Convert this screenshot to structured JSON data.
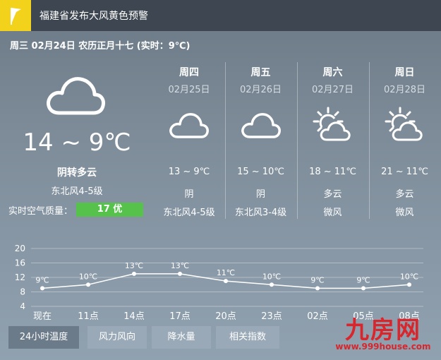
{
  "alert": {
    "text": "福建省发布大风黄色预警",
    "icon": "flag-icon",
    "color": "#f2d21b"
  },
  "date_line": "周三 02月24日 农历正月十七 (实时：9℃)",
  "today": {
    "icon": "cloud-icon",
    "temp": "14 ~ 9℃",
    "condition": "阴转多云",
    "wind": "东北风4-5级",
    "aqi_label": "实时空气质量：",
    "aqi_value": "17 优",
    "aqi_color": "#57c24b"
  },
  "forecast": [
    {
      "day": "周四",
      "date": "02月25日",
      "icon": "cloud-icon",
      "temp": "13 ~ 9℃",
      "condition": "阴",
      "wind": "东北风4-5级"
    },
    {
      "day": "周五",
      "date": "02月26日",
      "icon": "cloud-icon",
      "temp": "15 ~ 10℃",
      "condition": "阴",
      "wind": "东北风3-4级"
    },
    {
      "day": "周六",
      "date": "02月27日",
      "icon": "sun-cloud-icon",
      "temp": "18 ~ 11℃",
      "condition": "多云",
      "wind": "微风"
    },
    {
      "day": "周日",
      "date": "02月28日",
      "icon": "sun-cloud-icon",
      "temp": "21 ~ 11℃",
      "condition": "多云",
      "wind": "微风"
    }
  ],
  "chart_data": {
    "type": "line",
    "categories": [
      "现在",
      "11点",
      "14点",
      "17点",
      "20点",
      "23点",
      "02点",
      "05点",
      "08点"
    ],
    "series": [
      {
        "values": [
          9,
          10,
          13,
          13,
          11,
          10,
          9,
          9,
          10
        ]
      }
    ],
    "data_labels": [
      "9℃",
      "10℃",
      "13℃",
      "13℃",
      "11℃",
      "10℃",
      "9℃",
      "9℃",
      "10℃"
    ],
    "yticks": [
      "20",
      "16",
      "12",
      "8",
      "4"
    ],
    "ylim": [
      4,
      20
    ],
    "grid": true
  },
  "tabs": [
    {
      "label": "24小时温度",
      "active": true
    },
    {
      "label": "风力风向",
      "active": false
    },
    {
      "label": "降水量",
      "active": false
    },
    {
      "label": "相关指数",
      "active": false
    }
  ],
  "watermark": {
    "text": "九房网",
    "url": "www.999house.com"
  }
}
